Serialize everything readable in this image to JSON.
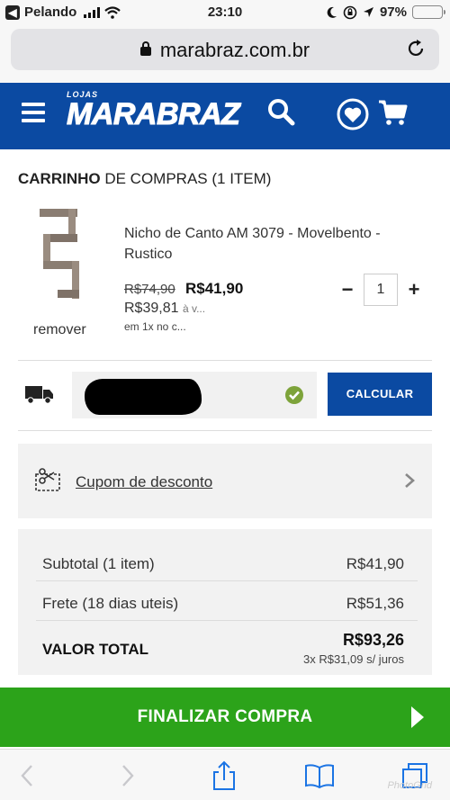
{
  "status_bar": {
    "carrier": "Pelando",
    "time": "23:10",
    "battery": "97%",
    "battery_level": 0.97
  },
  "browser": {
    "url": "marabraz.com.br"
  },
  "header": {
    "logo_small": "LOJAS",
    "logo_brand": "MARABRAZ",
    "bg_color": "#0b4aa2"
  },
  "cart": {
    "title_bold": "CARRINHO",
    "title_rest": " DE COMPRAS (1 ITEM)",
    "item": {
      "name": "Nicho de Canto AM 3079 - Movelbento - Rustico",
      "old_price": "R$74,90",
      "price": "R$41,90",
      "cash_price": "R$39,81",
      "cash_note": "à v...",
      "installments": "em 1x no c...",
      "quantity": "1",
      "remove_label": "remover",
      "minus": "−",
      "plus": "+"
    }
  },
  "shipping": {
    "calc_label": "CALCULAR"
  },
  "coupon": {
    "label": "Cupom de desconto"
  },
  "summary": {
    "subtotal_label": "Subtotal (1 item)",
    "subtotal_value": "R$41,90",
    "freight_label": "Frete (18 dias uteis)",
    "freight_value": "R$51,36",
    "total_label": "VALOR TOTAL",
    "total_value": "R$93,26",
    "total_installments": "3x R$31,09 s/ juros"
  },
  "finalize": {
    "label": "FINALIZAR COMPRA",
    "color": "#2ca31a"
  },
  "toolbar": {
    "watermark": "PhotoGrid"
  }
}
